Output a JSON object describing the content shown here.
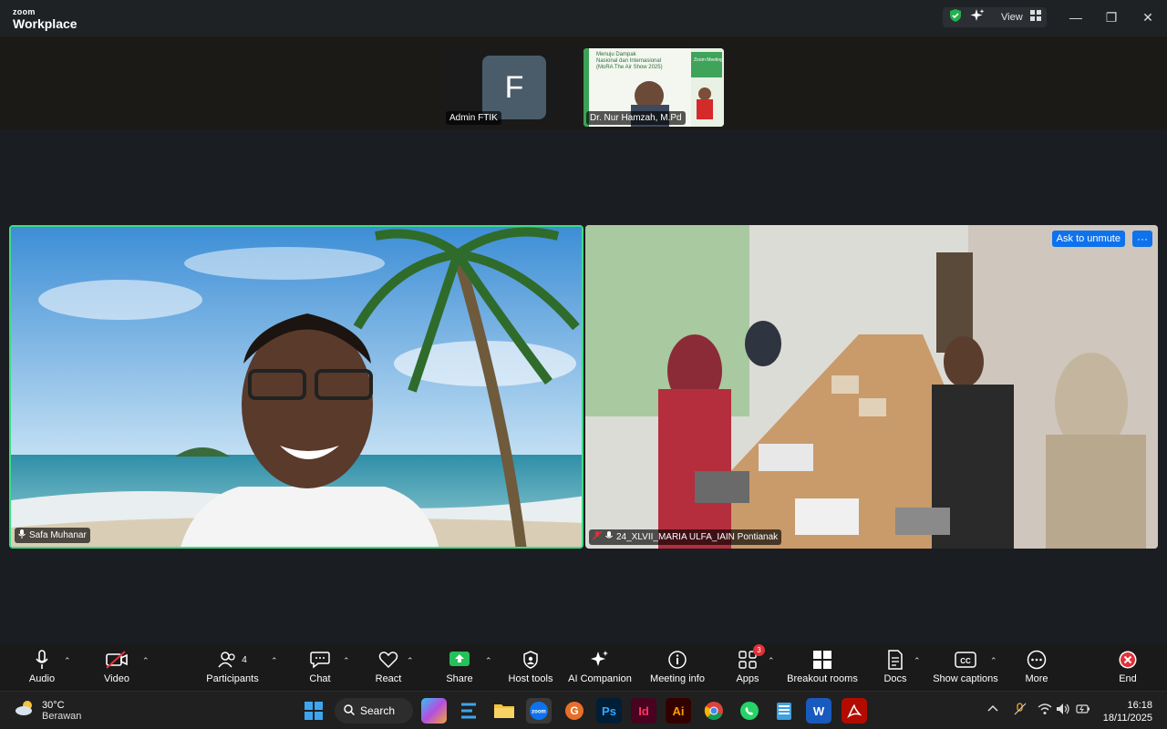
{
  "titlebar": {
    "logo_top": "zoom",
    "logo_bottom": "Workplace",
    "view_label": "View",
    "minimize": "—",
    "restore": "❐",
    "close": "✕"
  },
  "participants_strip": {
    "admin": {
      "initial": "F",
      "name": "Admin FTIK"
    },
    "nur": {
      "name": "Dr. Nur Hamzah, M.Pd",
      "slide_line1": "Menuju Dampak",
      "slide_line2": "Nasional dan Internasional",
      "slide_line3": "(MoRA The Air Show 2025)",
      "slide_badge": "Zoom Meeting"
    }
  },
  "stage": {
    "left_name": "Safa Muhanar",
    "right_name": "24_XLVII_MARIA ULFA_IAIN Pontianak",
    "ask_to_unmute": "Ask to unmute",
    "more_glyph": "···"
  },
  "toolbar": {
    "audio": "Audio",
    "video": "Video",
    "participants": "Participants",
    "participants_count": "4",
    "chat": "Chat",
    "react": "React",
    "share": "Share",
    "host_tools": "Host tools",
    "ai_companion": "AI Companion",
    "meeting_info": "Meeting info",
    "apps": "Apps",
    "apps_badge": "3",
    "breakout_rooms": "Breakout rooms",
    "docs": "Docs",
    "show_captions": "Show captions",
    "more": "More",
    "end": "End",
    "caret": "⌃"
  },
  "taskbar": {
    "temp": "30°C",
    "weather": "Berawan",
    "search": "Search",
    "time": "16:18",
    "date": "18/11/2025"
  },
  "colors": {
    "active_border": "#3ddc84",
    "ask_unmute_bg": "#0e72ed",
    "share_green": "#24c05a",
    "end_red": "#e0313a"
  }
}
